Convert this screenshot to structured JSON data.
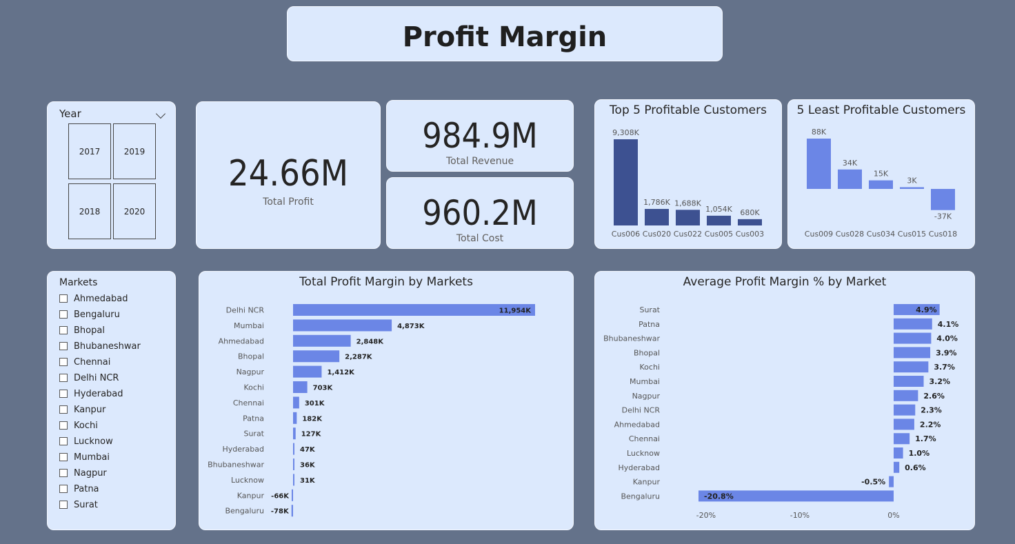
{
  "title": "Profit Margin",
  "year_slicer": {
    "label": "Year",
    "options": [
      "2017",
      "2019",
      "2018",
      "2020"
    ]
  },
  "kpis": {
    "profit": {
      "value": "24.66M",
      "label": "Total Profit"
    },
    "revenue": {
      "value": "984.9M",
      "label": "Total Revenue"
    },
    "cost": {
      "value": "960.2M",
      "label": "Total Cost"
    }
  },
  "markets_slicer": {
    "label": "Markets",
    "items": [
      "Ahmedabad",
      "Bengaluru",
      "Bhopal",
      "Bhubaneshwar",
      "Chennai",
      "Delhi NCR",
      "Hyderabad",
      "Kanpur",
      "Kochi",
      "Lucknow",
      "Mumbai",
      "Nagpur",
      "Patna",
      "Surat"
    ]
  },
  "colors": {
    "background": "#64728a",
    "card": "#dce9fd",
    "dark_bar": "#3d5191",
    "light_bar": "#6b86e6"
  },
  "chart_data": [
    {
      "type": "bar",
      "title": "Top 5 Profitable Customers",
      "categories": [
        "Cus006",
        "Cus020",
        "Cus022",
        "Cus005",
        "Cus003"
      ],
      "values": [
        9308,
        1786,
        1688,
        1054,
        680
      ],
      "labels": [
        "9,308K",
        "1,786K",
        "1,688K",
        "1,054K",
        "680K"
      ],
      "color": "#3d5191"
    },
    {
      "type": "bar",
      "title": "5 Least Profitable Customers",
      "categories": [
        "Cus009",
        "Cus028",
        "Cus034",
        "Cus015",
        "Cus018"
      ],
      "values": [
        88,
        34,
        15,
        3,
        -37
      ],
      "labels": [
        "88K",
        "34K",
        "15K",
        "3K",
        "-37K"
      ],
      "color": "#6b86e6"
    },
    {
      "type": "bar",
      "orientation": "horizontal",
      "title": "Total Profit Margin by Markets",
      "categories": [
        "Delhi NCR",
        "Mumbai",
        "Ahmedabad",
        "Bhopal",
        "Nagpur",
        "Kochi",
        "Chennai",
        "Patna",
        "Surat",
        "Hyderabad",
        "Bhubaneshwar",
        "Lucknow",
        "Kanpur",
        "Bengaluru"
      ],
      "values": [
        11954,
        4873,
        2848,
        2287,
        1412,
        703,
        301,
        182,
        127,
        47,
        36,
        31,
        -66,
        -78
      ],
      "labels": [
        "11,954K",
        "4,873K",
        "2,848K",
        "2,287K",
        "1,412K",
        "703K",
        "301K",
        "182K",
        "127K",
        "47K",
        "36K",
        "31K",
        "-66K",
        "-78K"
      ],
      "color": "#6b86e6"
    },
    {
      "type": "bar",
      "orientation": "horizontal",
      "title": "Average Profit Margin % by Market",
      "categories": [
        "Surat",
        "Patna",
        "Bhubaneshwar",
        "Bhopal",
        "Kochi",
        "Mumbai",
        "Nagpur",
        "Delhi NCR",
        "Ahmedabad",
        "Chennai",
        "Lucknow",
        "Hyderabad",
        "Kanpur",
        "Bengaluru"
      ],
      "values": [
        4.9,
        4.1,
        4.0,
        3.9,
        3.7,
        3.2,
        2.6,
        2.3,
        2.2,
        1.7,
        1.0,
        0.6,
        -0.5,
        -20.8
      ],
      "labels": [
        "4.9%",
        "4.1%",
        "4.0%",
        "3.9%",
        "3.7%",
        "3.2%",
        "2.6%",
        "2.3%",
        "2.2%",
        "1.7%",
        "1.0%",
        "0.6%",
        "-0.5%",
        "-20.8%"
      ],
      "x_ticks": [
        "-20%",
        "-10%",
        "0%"
      ],
      "x_tick_values": [
        -20,
        -10,
        0
      ],
      "color": "#6b86e6"
    }
  ]
}
